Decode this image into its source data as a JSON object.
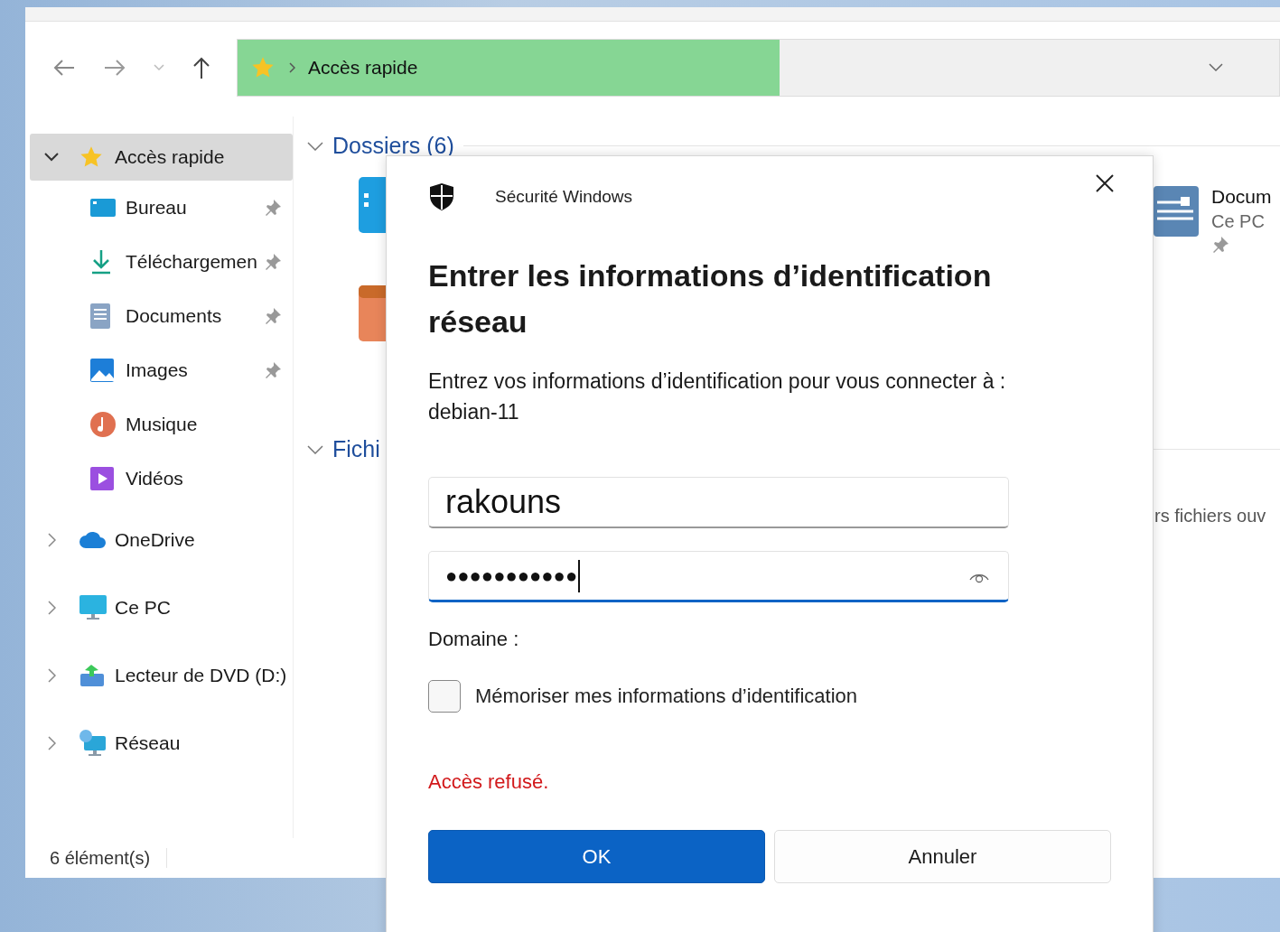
{
  "explorer": {
    "address": {
      "segments": [
        "Accès rapide"
      ]
    },
    "sidebar": {
      "items": [
        {
          "label": "Accès rapide",
          "expanded": true,
          "selected": true,
          "children": [
            {
              "label": "Bureau",
              "pinned": true,
              "selected": false
            },
            {
              "label": "Téléchargemen",
              "pinned": true,
              "selected": false
            },
            {
              "label": "Documents",
              "pinned": true,
              "selected": false
            },
            {
              "label": "Images",
              "pinned": true,
              "selected": false
            },
            {
              "label": "Musique",
              "pinned": false,
              "selected": false
            },
            {
              "label": "Vidéos",
              "pinned": false,
              "selected": false
            }
          ]
        },
        {
          "label": "OneDrive",
          "expanded": false,
          "selected": false
        },
        {
          "label": "Ce PC",
          "expanded": false,
          "selected": false
        },
        {
          "label": "Lecteur de DVD (D:)",
          "expanded": false,
          "selected": false
        },
        {
          "label": "Réseau",
          "expanded": false,
          "selected": false
        }
      ]
    },
    "sections": [
      {
        "title": "Dossiers (6)",
        "expanded": true
      },
      {
        "title": "Fichi",
        "expanded": true
      }
    ],
    "folder_tile": {
      "name": "Docum",
      "location": "Ce PC",
      "pinned": true
    },
    "recent_note": "rs fichiers ouv",
    "status_bar": {
      "count": "6 élément(s)"
    }
  },
  "dialog": {
    "app_title": "Sécurité Windows",
    "heading": "Entrer les informations d’identification réseau",
    "description": "Entrez vos informations d’identification pour vous connecter à : debian-11",
    "username": {
      "value": "rakouns",
      "focused": false
    },
    "password": {
      "value": "●●●●●●●●●●●",
      "focused": true
    },
    "domain_label": "Domaine :",
    "remember": {
      "label": "Mémoriser mes informations d’identification",
      "checked": false
    },
    "error": "Accès refusé.",
    "buttons": [
      {
        "label": "OK",
        "primary": true
      },
      {
        "label": "Annuler",
        "primary": false
      }
    ]
  }
}
